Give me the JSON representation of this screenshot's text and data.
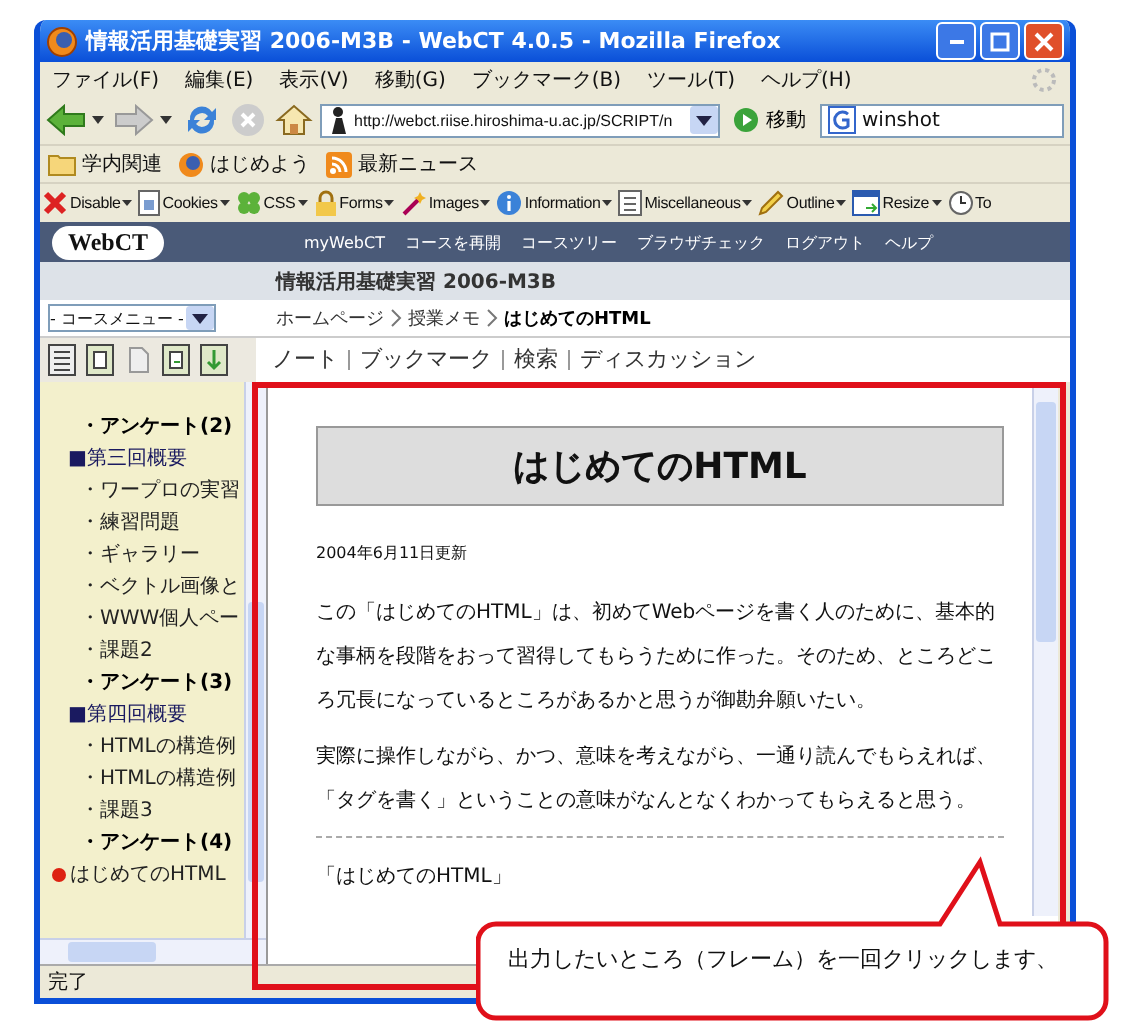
{
  "window": {
    "title": "情報活用基礎実習 2006-M3B - WebCT 4.0.5 - Mozilla Firefox"
  },
  "menu": [
    "ファイル(F)",
    "編集(E)",
    "表示(V)",
    "移動(G)",
    "ブックマーク(B)",
    "ツール(T)",
    "ヘルプ(H)"
  ],
  "nav": {
    "url": "http://webct.riise.hiroshima-u.ac.jp/SCRIPT/n",
    "go": "移動",
    "search": "winshot"
  },
  "bookmarks": [
    {
      "label": "学内関連",
      "kind": "folder"
    },
    {
      "label": "はじめよう",
      "kind": "globe"
    },
    {
      "label": "最新ニュース",
      "kind": "feed"
    }
  ],
  "devtools": [
    {
      "label": "Disable",
      "kind": "cross",
      "dropdown": true
    },
    {
      "label": "Cookies",
      "kind": "page",
      "dropdown": true
    },
    {
      "label": "CSS",
      "kind": "clover",
      "dropdown": true
    },
    {
      "label": "Forms",
      "kind": "padlock",
      "dropdown": true
    },
    {
      "label": "Images",
      "kind": "wand",
      "dropdown": true
    },
    {
      "label": "Information",
      "kind": "info",
      "dropdown": true
    },
    {
      "label": "Miscellaneous",
      "kind": "list",
      "dropdown": true
    },
    {
      "label": "Outline",
      "kind": "pencil",
      "dropdown": true
    },
    {
      "label": "Resize",
      "kind": "window",
      "dropdown": true
    },
    {
      "label": "To",
      "kind": "clock",
      "dropdown": false
    }
  ],
  "webct": {
    "logo": "WebCT",
    "links": [
      "myWebCT",
      "コースを再開",
      "コースツリー",
      "ブラウザチェック",
      "ログアウト",
      "ヘルプ"
    ]
  },
  "course_title": "情報活用基礎実習 2006-M3B",
  "course_menu": "- コースメニュー -",
  "breadcrumb": [
    {
      "label": "ホームページ",
      "current": false
    },
    {
      "label": "授業メモ",
      "current": false
    },
    {
      "label": "はじめてのHTML",
      "current": true
    }
  ],
  "tools": [
    "ノート",
    "ブックマーク",
    "検索",
    "ディスカッション"
  ],
  "sidebar": [
    {
      "label": "・アンケート(2)",
      "kind": "bold"
    },
    {
      "label": "■第三回概要",
      "kind": "heading"
    },
    {
      "label": "・ワープロの実習",
      "kind": "item"
    },
    {
      "label": "・練習問題",
      "kind": "item"
    },
    {
      "label": "・ギャラリー",
      "kind": "item"
    },
    {
      "label": "・ベクトル画像と",
      "kind": "item"
    },
    {
      "label": "・WWW個人ペー",
      "kind": "item"
    },
    {
      "label": "・課題2",
      "kind": "item"
    },
    {
      "label": "・アンケート(3)",
      "kind": "bold"
    },
    {
      "label": "■第四回概要",
      "kind": "heading"
    },
    {
      "label": "・HTMLの構造例",
      "kind": "item"
    },
    {
      "label": "・HTMLの構造例",
      "kind": "item"
    },
    {
      "label": "・課題3",
      "kind": "item"
    },
    {
      "label": "・アンケート(4)",
      "kind": "bold"
    },
    {
      "label": "はじめてのHTML",
      "kind": "current"
    }
  ],
  "page": {
    "heading": "はじめてのHTML",
    "date": "2004年6月11日更新",
    "paragraphs": [
      "この「はじめてのHTML」は、初めてWebページを書く人のために、基本的な事柄を段階をおって習得してもらうために作った。そのため、ところどころ冗長になっているところがあるかと思うが御勘弁願いたい。",
      "実際に操作しながら、かつ、意味を考えながら、一通り読んでもらえれば、「タグを書く」ということの意味がなんとなくわかってもらえると思う。"
    ],
    "footer_text": "「はじめてのHTML」"
  },
  "status": "完了",
  "callout": "出力したいところ（フレーム）を一回クリックします、"
}
